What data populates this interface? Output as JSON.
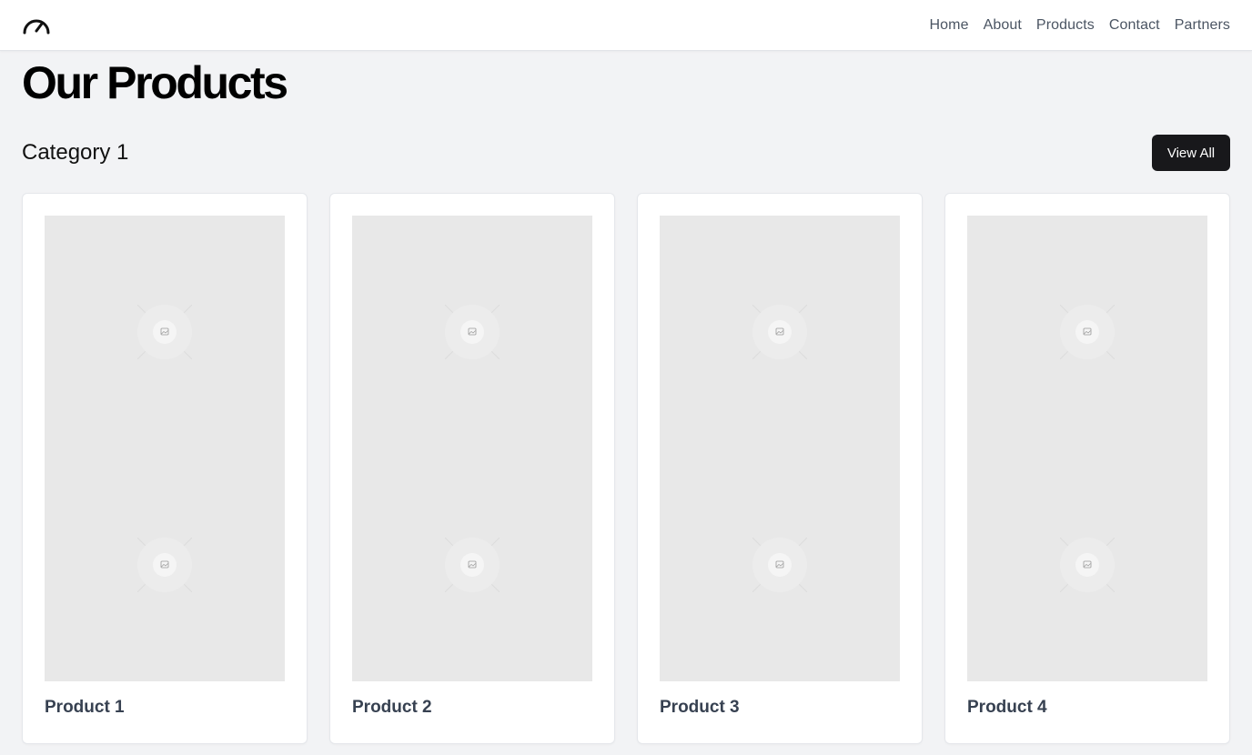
{
  "nav": {
    "logo_icon": "gauge-icon",
    "links": [
      "Home",
      "About",
      "Products",
      "Contact",
      "Partners"
    ]
  },
  "page": {
    "title": "Our Products"
  },
  "section": {
    "title": "Category 1",
    "view_all_label": "View All"
  },
  "products": [
    {
      "name": "Product 1",
      "image_icon": "image-placeholder-icon"
    },
    {
      "name": "Product 2",
      "image_icon": "image-placeholder-icon"
    },
    {
      "name": "Product 3",
      "image_icon": "image-placeholder-icon"
    },
    {
      "name": "Product 4",
      "image_icon": "image-placeholder-icon"
    }
  ],
  "colors": {
    "background": "#f2f3f5",
    "button": "#18181b",
    "image_placeholder": "#e8e8e8"
  }
}
